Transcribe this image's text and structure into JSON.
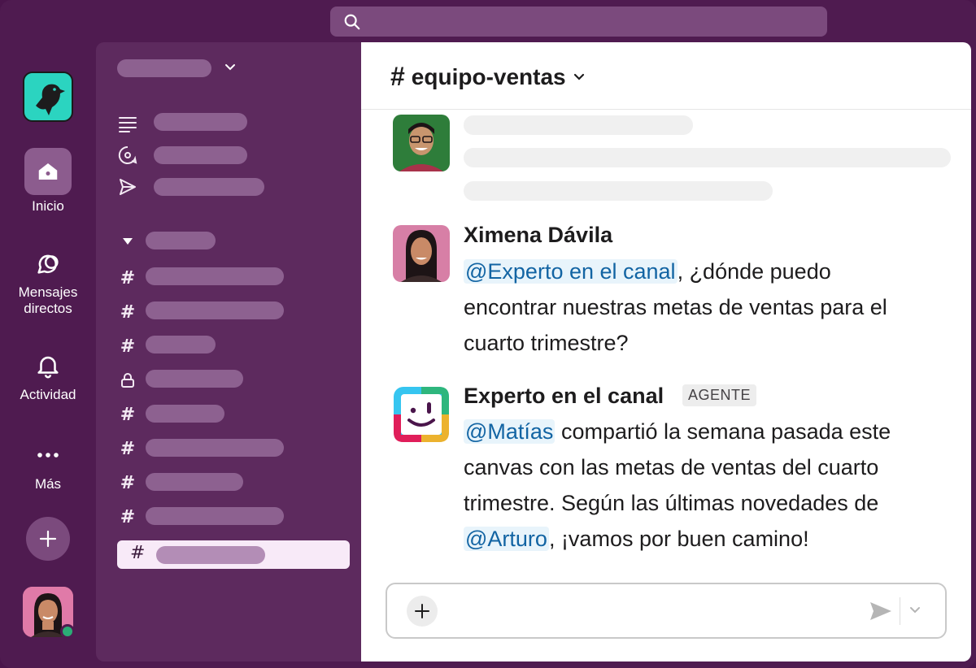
{
  "rail": {
    "home_label": "Inicio",
    "dms_label_1": "Mensajes",
    "dms_label_2": "directos",
    "activity_label": "Actividad",
    "more_label": "Más"
  },
  "channel": {
    "hash": "#",
    "name": "equipo-ventas"
  },
  "messages": [
    {
      "author": "Ximena Dávila",
      "mention": "@Experto en el canal",
      "text_after_mention": ", ¿dónde puedo",
      "line2": "encontrar nuestras metas de ventas para el",
      "line3": "cuarto trimestre?"
    },
    {
      "author": "Experto en el canal",
      "badge": "AGENTE",
      "mention1": "@Matías",
      "text1": " compartió la semana pasada este",
      "line2": "canvas con las metas de ventas del cuarto",
      "line3": "trimestre. Según las últimas novedades de",
      "mention2": "@Arturo",
      "text_end": ", ¡vamos por buen camino!"
    }
  ],
  "colors": {
    "aubergine": "#4f1b50",
    "sidebar": "#5d2a5e",
    "mention_bg": "#e8f4fb",
    "mention_fg": "#1264a3",
    "presence": "#2bac76",
    "logo_teal": "#2bd4c0"
  },
  "icons": [
    "search-icon",
    "home-icon",
    "dm-icon",
    "bell-icon",
    "more-icon",
    "plus-icon",
    "threads-icon",
    "mentions-icon",
    "send-icon",
    "hash-icon",
    "lock-icon",
    "caret-down-icon",
    "chevron-down-icon"
  ]
}
